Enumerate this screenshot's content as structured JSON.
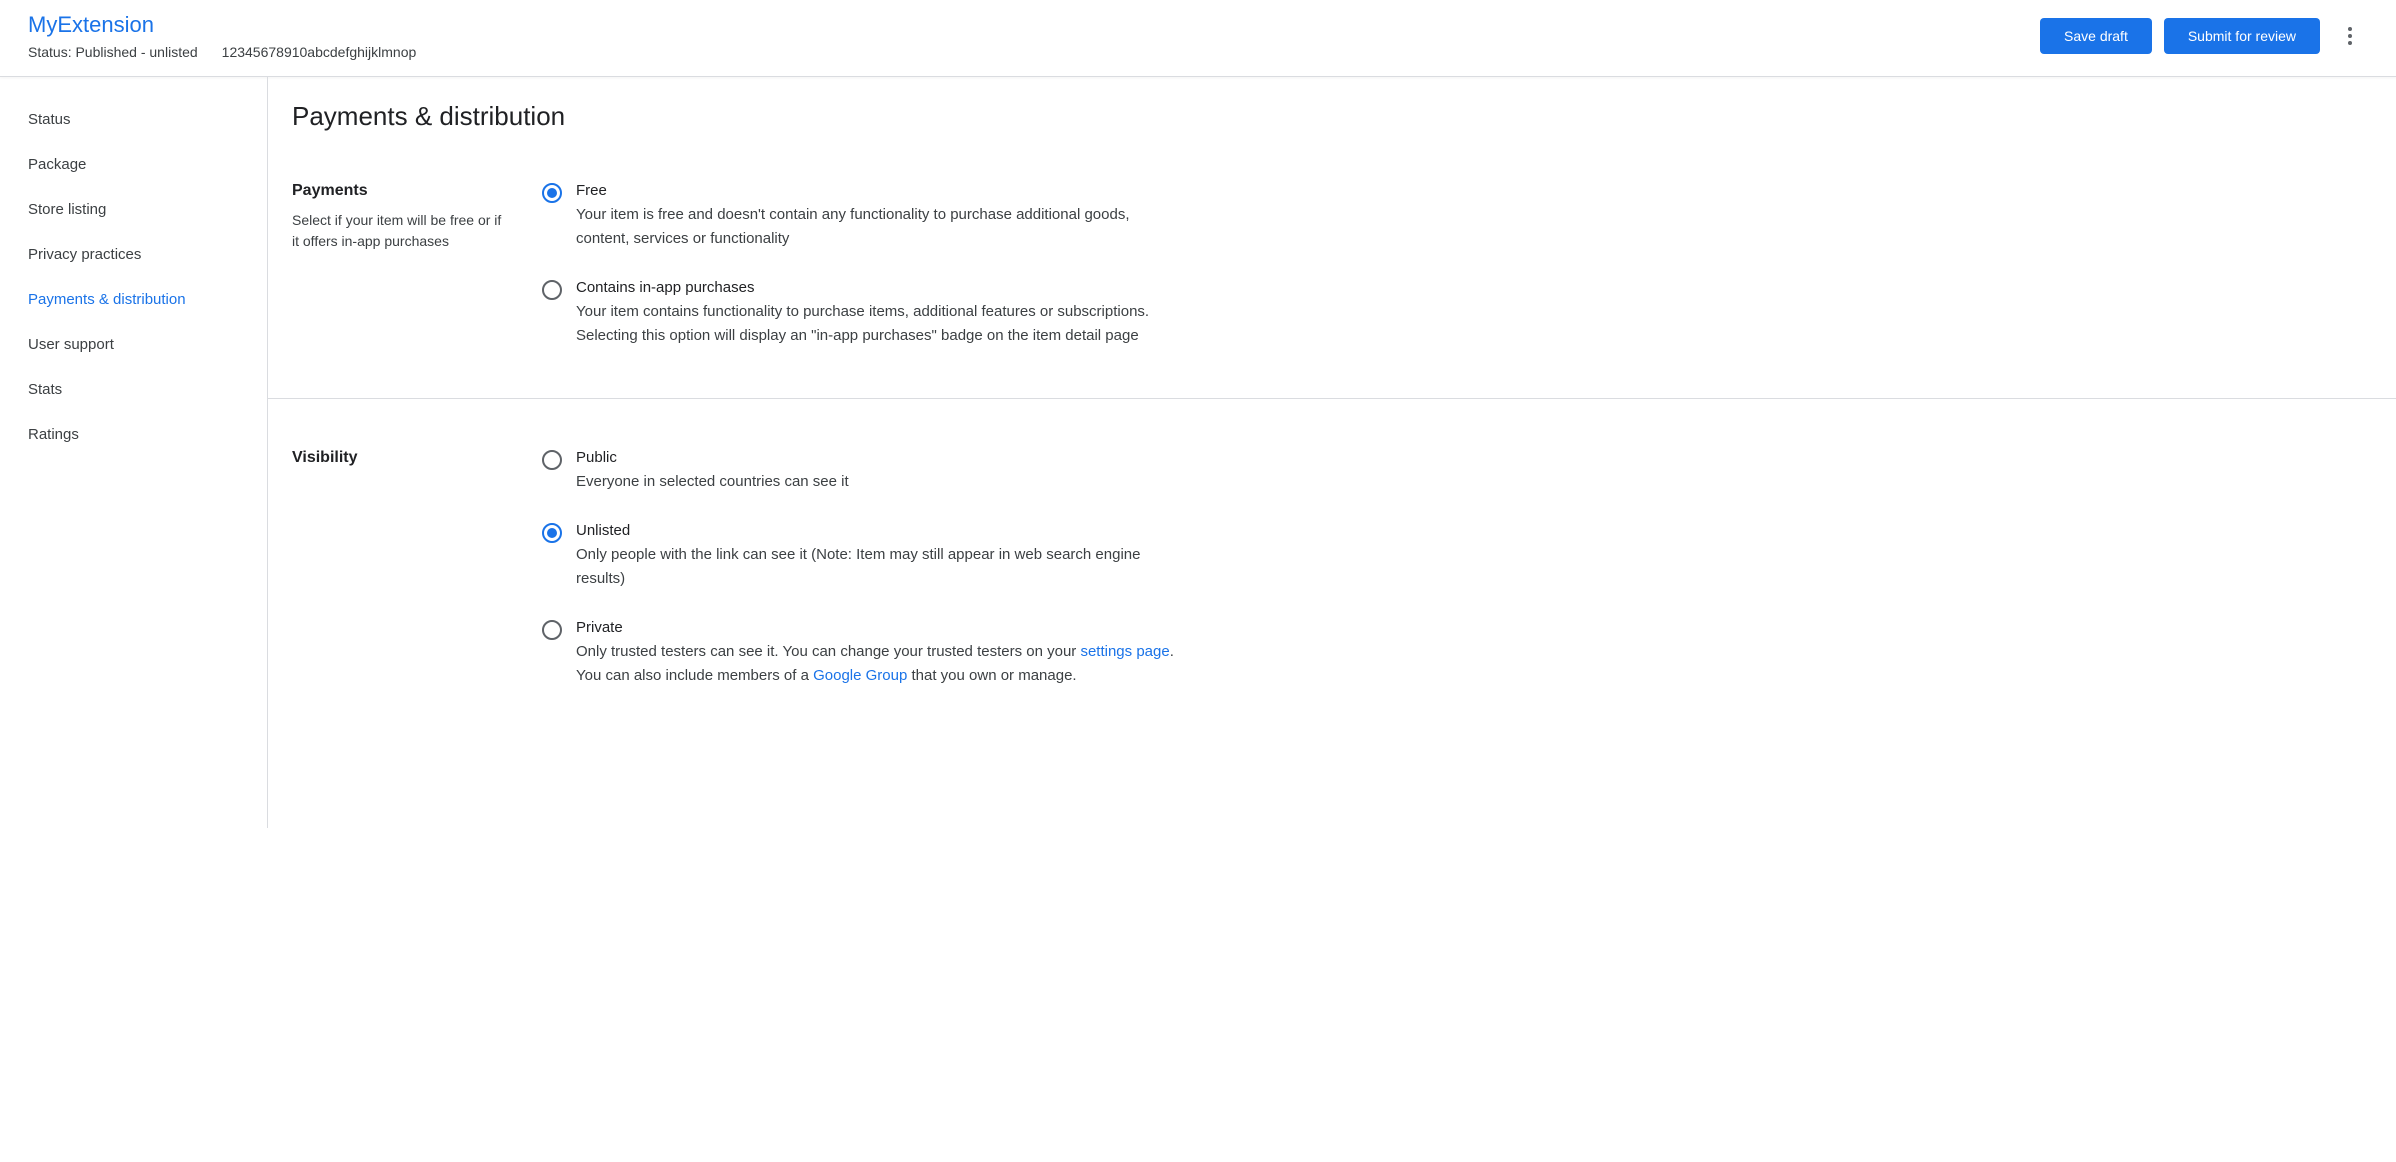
{
  "header": {
    "title": "MyExtension",
    "status": "Status: Published - unlisted",
    "item_id": "12345678910abcdefghijklmnop",
    "save_draft_label": "Save draft",
    "submit_label": "Submit for review"
  },
  "sidebar": {
    "items": [
      {
        "label": "Status",
        "active": false
      },
      {
        "label": "Package",
        "active": false
      },
      {
        "label": "Store listing",
        "active": false
      },
      {
        "label": "Privacy practices",
        "active": false
      },
      {
        "label": "Payments & distribution",
        "active": true
      },
      {
        "label": "User support",
        "active": false
      },
      {
        "label": "Stats",
        "active": false
      },
      {
        "label": "Ratings",
        "active": false
      }
    ]
  },
  "main": {
    "page_title": "Payments & distribution",
    "payments": {
      "title": "Payments",
      "description": "Select if your item will be free or if it offers in-app purchases",
      "options": [
        {
          "label": "Free",
          "description": "Your item is free and doesn't contain any functionality to purchase additional goods, content, services or functionality",
          "selected": true
        },
        {
          "label": "Contains in-app purchases",
          "description": "Your item contains functionality to purchase items, additional features or subscriptions. Selecting this option will display an \"in-app purchases\" badge on the item detail page",
          "selected": false
        }
      ]
    },
    "visibility": {
      "title": "Visibility",
      "options": [
        {
          "label": "Public",
          "description": "Everyone in selected countries can see it",
          "selected": false
        },
        {
          "label": "Unlisted",
          "description": "Only people with the link can see it (Note: Item may still appear in web search engine results)",
          "selected": true
        },
        {
          "label": "Private",
          "desc_prefix": "Only trusted testers can see it. You can change your trusted testers on your ",
          "settings_link": "settings page",
          "desc_mid": ".",
          "desc_line2_prefix": "You can also include members of a ",
          "group_link": "Google Group",
          "desc_line2_suffix": " that you own or manage.",
          "selected": false
        }
      ]
    }
  }
}
